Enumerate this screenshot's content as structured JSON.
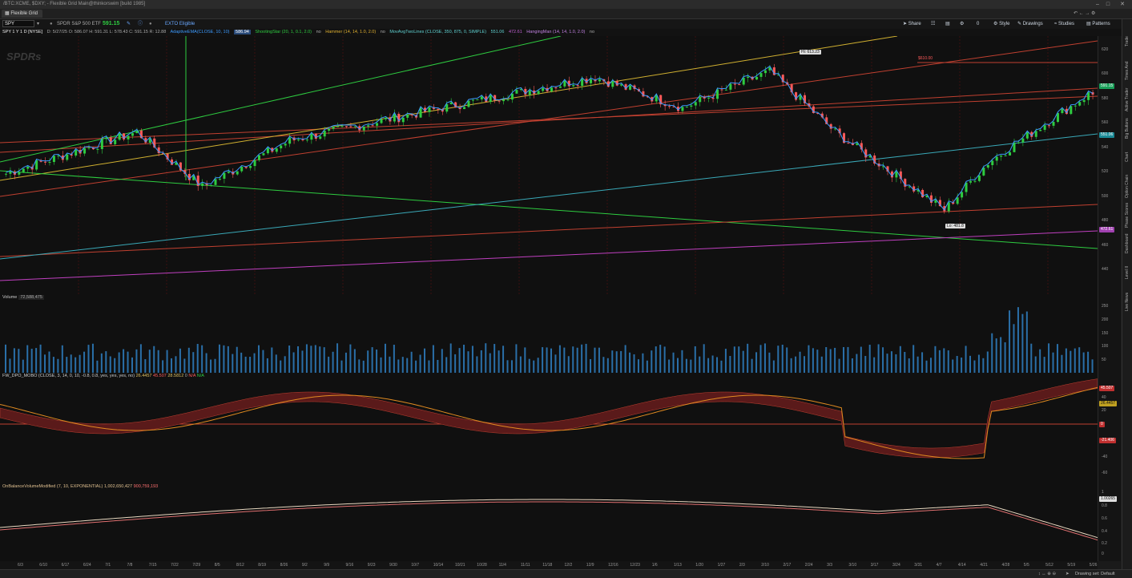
{
  "window": {
    "title": "/BTC:XCME, $DXY; - Flexible Grid Main@thinkorswim [build 1985]",
    "controls": [
      "minimize-icon",
      "maximize-icon",
      "close-icon"
    ]
  },
  "tab": {
    "label": "Flexible Grid"
  },
  "toolbar": {
    "symbol": "SPY",
    "description": "SPDR S&P 500 ETF",
    "last_price": "591.15",
    "exto": "EXTO Eligible",
    "share": "Share",
    "style": "Style",
    "drawings": "Drawings",
    "studies": "Studies",
    "patterns": "Patterns",
    "count": "0"
  },
  "studybar": {
    "chart_label": "SPY 1 Y 1 D [NYSE]",
    "ohlc": "D: 5/27/25  O: 586.07  H: 591.31  L: 578.43  C: 591.15  R: 12.88",
    "s1": "AdaptiveEMA(CLOSE, 10, 10)",
    "s1v": "586.94",
    "s2": "ShootingStar (20, 1, 0.1, 2.0)",
    "s2v": "no",
    "s3": "Hammer (14, 14, 1.0, 2.0)",
    "s3v": "no",
    "s4": "MovAvgTwoLines (CLOSE, 350, 875, 0, SIMPLE)",
    "s4v": "551.06",
    "s4v2": "472.61",
    "s5": "HangingMan (14, 14, 1.0, 2.0)",
    "s5v": "no"
  },
  "price_pane": {
    "ticks": [
      "620",
      "600",
      "580",
      "560",
      "540",
      "520",
      "500",
      "480",
      "460",
      "440"
    ],
    "last_tag": "591.15",
    "ma_tag": "551.06",
    "ma2_tag": "472.61",
    "hi_label": "Hi: 613.23",
    "lo_label": "Lo: 481.8",
    "alert_label": "$610.00",
    "colors": {
      "up": "#2ecc40",
      "down": "#ff5a5a",
      "ma_fast": "#3c9bff",
      "ma_slow": "#3aa9b8",
      "ma_long": "#c060d0"
    }
  },
  "volume_pane": {
    "title": "Volume",
    "value": "72,588,475",
    "ticks": [
      "250",
      "200",
      "150",
      "100",
      "50"
    ]
  },
  "dpo_pane": {
    "title": "FW_DPO_MOBO (CLOSE, 3, 14, 0, 10, -0.8, 0.8, yes, yes, yes, no)",
    "v1": "26.4457",
    "v2": "45.507",
    "v3": "28.5812",
    "v4": "0",
    "v5": "N/A",
    "v6": "N/A",
    "ticks": [
      "40",
      "20",
      "0",
      "-20",
      "-40",
      "-60"
    ],
    "tag1": "45.507",
    "tag2": "26.4457",
    "tag3": "0",
    "tag4": "-21.406"
  },
  "obv_pane": {
    "title": "OnBalanceVolumeModified (7, 10, EXPONENTIAL)",
    "v1": "1,002,650,427",
    "v2": "900,759,193",
    "ticks": [
      "1",
      "0.8",
      "0.6",
      "0.4",
      "0.2",
      "0"
    ],
    "tag": "1.00265"
  },
  "x_dates": [
    "6/3",
    "6/10",
    "6/17",
    "6/24",
    "7/1",
    "7/8",
    "7/15",
    "7/22",
    "7/29",
    "8/5",
    "8/12",
    "8/19",
    "8/26",
    "9/2",
    "9/9",
    "9/16",
    "9/23",
    "9/30",
    "10/7",
    "10/14",
    "10/21",
    "10/28",
    "11/4",
    "11/11",
    "11/18",
    "12/2",
    "12/9",
    "12/16",
    "12/23",
    "1/6",
    "1/13",
    "1/20",
    "1/27",
    "2/3",
    "2/10",
    "2/17",
    "2/24",
    "3/3",
    "3/10",
    "3/17",
    "3/24",
    "3/31",
    "4/7",
    "4/14",
    "4/21",
    "4/28",
    "5/5",
    "5/12",
    "5/19",
    "5/26"
  ],
  "sidebar": [
    "Trade",
    "Times And Sales",
    "Active Trader",
    "Big Buttons",
    "Chart",
    "Option Chain",
    "Phase Scores",
    "Dashboard",
    "Level II",
    "Live News"
  ],
  "status": {
    "drawing_set": "Drawing set: Default"
  },
  "chart_data": {
    "type": "candlestick",
    "x": [
      "6/3",
      "7/15",
      "8/5",
      "9/2",
      "10/21",
      "12/9",
      "1/13",
      "2/17",
      "3/10",
      "4/7",
      "4/21",
      "5/19"
    ],
    "close_estimate": [
      526,
      560,
      515,
      553,
      580,
      605,
      580,
      610,
      560,
      496,
      535,
      591
    ]
  }
}
